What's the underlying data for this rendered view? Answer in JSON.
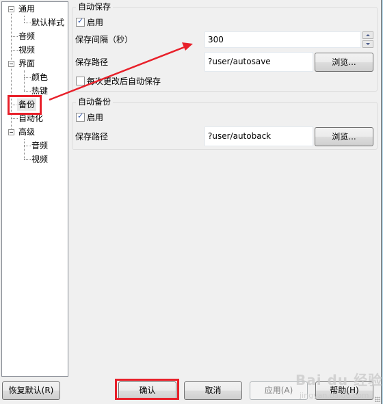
{
  "tree": {
    "items": [
      {
        "label": "通用",
        "level": 0,
        "expanded": true
      },
      {
        "label": "默认样式",
        "level": 1
      },
      {
        "label": "音频",
        "level": 0
      },
      {
        "label": "视频",
        "level": 0
      },
      {
        "label": "界面",
        "level": 0,
        "expanded": true
      },
      {
        "label": "颜色",
        "level": 1
      },
      {
        "label": "热键",
        "level": 1
      },
      {
        "label": "备份",
        "level": 0,
        "selected": true
      },
      {
        "label": "自动化",
        "level": 0
      },
      {
        "label": "高级",
        "level": 0,
        "expanded": true
      },
      {
        "label": "音频",
        "level": 1
      },
      {
        "label": "视频",
        "level": 1
      }
    ]
  },
  "autosave": {
    "title": "自动保存",
    "enable_label": "启用",
    "enable_checked": true,
    "interval_label": "保存间隔（秒）",
    "interval_value": "300",
    "path_label": "保存路径",
    "path_value": "?user/autosave",
    "browse_label": "浏览...",
    "save_on_change_label": "每次更改后自动保存",
    "save_on_change_checked": false
  },
  "autobackup": {
    "title": "自动备份",
    "enable_label": "启用",
    "enable_checked": true,
    "path_label": "保存路径",
    "path_value": "?user/autoback",
    "browse_label": "浏览..."
  },
  "footer": {
    "restore_defaults_label": "恢复默认(R)",
    "ok_label": "确认",
    "cancel_label": "取消",
    "apply_label": "应用(A)",
    "help_label": "帮助(H)"
  },
  "annotations": {
    "highlight_color": "#e8202a"
  },
  "watermark": {
    "text": "Bai du 经验",
    "sub": "jingyan.baidu.com"
  }
}
